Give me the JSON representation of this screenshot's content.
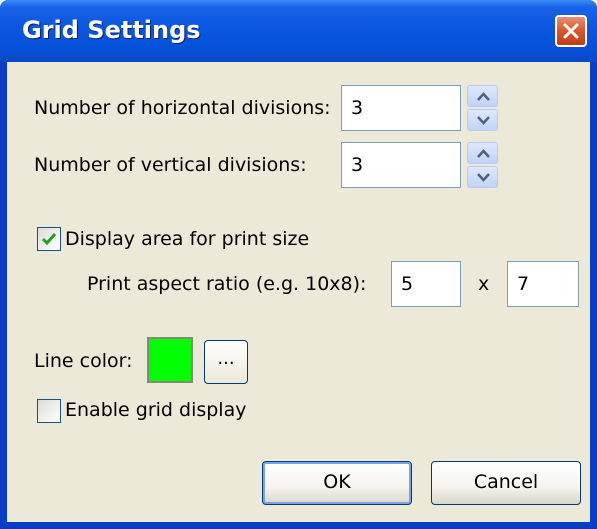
{
  "dialog": {
    "title": "Grid Settings"
  },
  "fields": {
    "horizontal_label": "Number of horizontal divisions:",
    "horizontal_value": "3",
    "vertical_label": "Number of vertical divisions:",
    "vertical_value": "3",
    "display_area_label": "Display area for print size",
    "display_area_checked": true,
    "aspect_label": "Print aspect ratio (e.g. 10x8):",
    "aspect_width": "5",
    "aspect_separator": "x",
    "aspect_height": "7",
    "line_color_label": "Line color:",
    "line_color": "#00ff00",
    "color_picker_label": "...",
    "enable_grid_label": "Enable grid display",
    "enable_grid_checked": false
  },
  "buttons": {
    "ok_label": "OK",
    "cancel_label": "Cancel"
  },
  "icons": {
    "close": "close-icon",
    "spin_up": "arrow-up-icon",
    "spin_down": "arrow-down-icon",
    "check": "checkmark-icon"
  }
}
